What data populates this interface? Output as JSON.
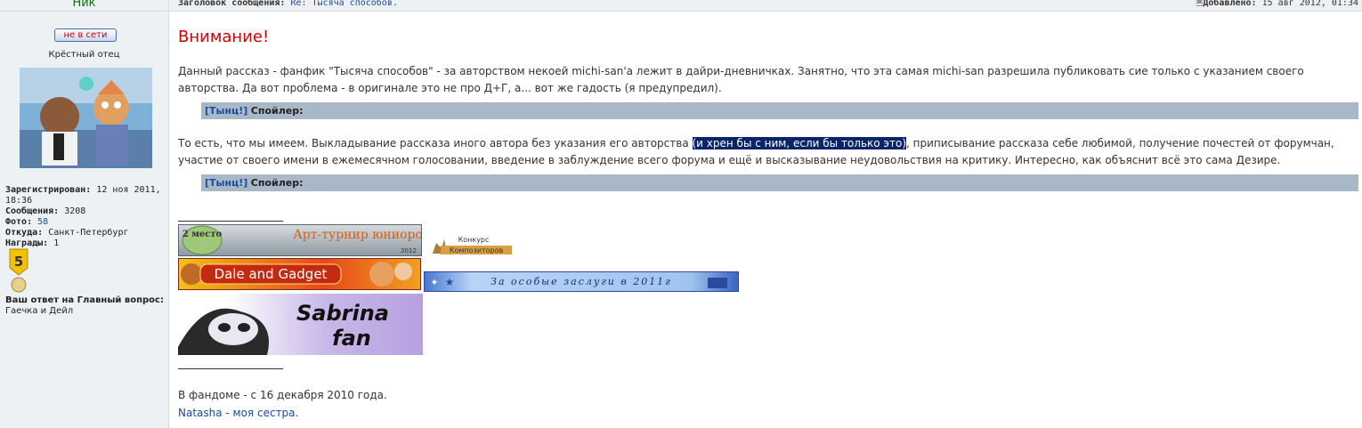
{
  "profile": {
    "nick_header": "Ник",
    "status": "не в сети",
    "rank": "Крёстный отец",
    "registered_label": "Зарегистрирован:",
    "registered_value": "12 ноя 2011, 18:36",
    "messages_label": "Сообщения:",
    "messages_value": "3208",
    "photo_label": "Фото:",
    "photo_value": "58",
    "from_label": "Откуда:",
    "from_value": "Санкт-Петербург",
    "awards_label": "Награды:",
    "awards_value": "1",
    "medal_number": "5",
    "answer_label": "Ваш ответ на Главный вопрос:",
    "answer_value": "Гаечка и Дейл"
  },
  "header": {
    "subject_label": "Заголовок сообщения:",
    "subject_value": "Re: Тысяча способов.",
    "added_label": "Добавлено:",
    "added_value": "15 авг 2012, 01:34"
  },
  "post": {
    "title": "Внимание!",
    "paragraph1": "Данный рассказ - фанфик \"Тысяча способов\" - за авторством некоей michi-san'а лежит в дайри-дневничках. Занятно, что эта самая michi-san разрешила публиковать сие только с указанием своего авторства. Да вот проблема - в оригинале это не про Д+Г, а... вот же гадость (я предупредил).",
    "spoiler_link": "[Тынц!]",
    "spoiler_label": "Спойлер:",
    "paragraph2_before": "То есть, что мы имеем. Выкладывание рассказа иного автора без указания его авторства ",
    "paragraph2_highlight": "(и хрен бы с ним, если бы только это)",
    "paragraph2_after": ", приписывание рассказа себе любимой, получение почестей от форумчан, участие от своего имени в ежемесячном голосовании, введение в заблуждение всего форума и ещё и высказывание неудовольствия на критику. Интересно, как объяснит всё это сама Дезире."
  },
  "signature": {
    "banner_art_place": "2 место",
    "banner_art_text": "Арт-турнир юниоров",
    "banner_art_year": "2012",
    "banner_konkurs_1": "Конкурс",
    "banner_konkurs_2": "Композиторов",
    "banner_dale": "Dale and Gadget",
    "banner_merit": "За особые заслуги в 2011г",
    "banner_sabrina_1": "Sabrina",
    "banner_sabrina_2": "fan",
    "fandom_line": "В фандоме - с 16 декабря 2010 года.",
    "sister_line": "Natasha - моя сестра."
  },
  "colors": {
    "title_red": "#d40000",
    "link_blue": "#1b4ca0",
    "spoiler_bg": "#a9b8c6",
    "highlight_bg": "#0a246a",
    "sidebar_bg": "#eef1f4"
  }
}
